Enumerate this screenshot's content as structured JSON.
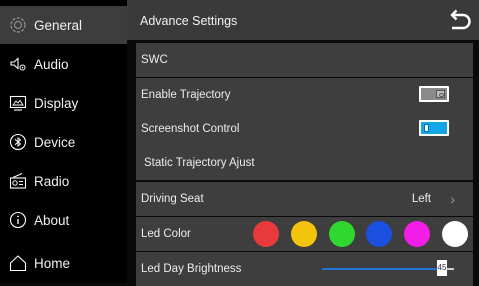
{
  "sidebar": {
    "items": [
      {
        "label": "General",
        "icon": "gear-icon",
        "active": true
      },
      {
        "label": "Audio",
        "icon": "speaker-icon"
      },
      {
        "label": "Display",
        "icon": "display-icon"
      },
      {
        "label": "Device",
        "icon": "bluetooth-icon"
      },
      {
        "label": "Radio",
        "icon": "radio-icon"
      },
      {
        "label": "About",
        "icon": "info-icon"
      },
      {
        "label": "Home",
        "icon": "home-icon"
      }
    ]
  },
  "header": {
    "title": "Advance Settings",
    "back_icon": "back-arrow-icon"
  },
  "settings": {
    "swc": "SWC",
    "enable_trajectory": {
      "label": "Enable Trajectory",
      "enabled": false
    },
    "screenshot_control": {
      "label": "Screenshot Control",
      "enabled": true
    },
    "static_trajectory": "Static Trajectory Ajust",
    "driving_seat": {
      "label": "Driving Seat",
      "value": "Left"
    },
    "led_color": {
      "label": "Led Color",
      "colors": [
        "#e83a3a",
        "#f5c40f",
        "#2fd82f",
        "#1a4fe0",
        "#f21de6",
        "#ffffff"
      ]
    },
    "led_day_brightness": {
      "label": "Led Day Brightness",
      "value": "45",
      "level_percent": 90
    }
  },
  "theme": {
    "accent": "#13a5e6",
    "slider": "#1f73d6",
    "active_bg": "#3d3d3d"
  }
}
